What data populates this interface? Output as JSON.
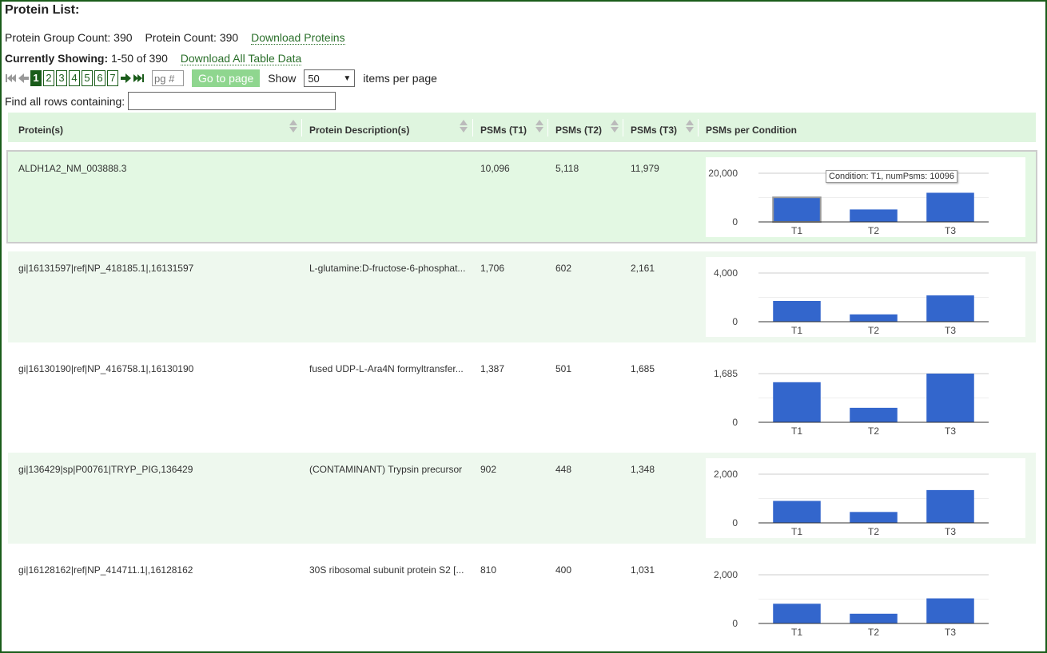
{
  "page": {
    "title": "Protein List:",
    "group_count_text": "Protein Group Count: 390",
    "protein_count_text": "Protein Count: 390",
    "download_proteins": "Download Proteins",
    "showing_label": "Currently Showing:",
    "showing_range": "1-50 of 390",
    "download_all": "Download All Table Data",
    "pages": [
      "1",
      "2",
      "3",
      "4",
      "5",
      "6",
      "7"
    ],
    "current_page": "1",
    "page_input_placeholder": "pg #",
    "go_button": "Go to page",
    "show_label": "Show",
    "per_page_value": "50",
    "items_per_page": "items per page",
    "find_label": "Find all rows containing:"
  },
  "table": {
    "headers": {
      "protein": "Protein(s)",
      "description": "Protein Description(s)",
      "t1": "PSMs (T1)",
      "t2": "PSMs (T2)",
      "t3": "PSMs (T3)",
      "per_condition": "PSMs per Condition"
    },
    "rows": [
      {
        "protein": "ALDH1A2_NM_003888.3",
        "description": "",
        "t1": "10,096",
        "t2": "5,118",
        "t3": "11,979"
      },
      {
        "protein": "gi|16131597|ref|NP_418185.1|,16131597",
        "description": "L-glutamine:D-fructose-6-phosphat...",
        "t1": "1,706",
        "t2": "602",
        "t3": "2,161"
      },
      {
        "protein": "gi|16130190|ref|NP_416758.1|,16130190",
        "description": "fused UDP-L-Ara4N formyltransfer...",
        "t1": "1,387",
        "t2": "501",
        "t3": "1,685"
      },
      {
        "protein": "gi|136429|sp|P00761|TRYP_PIG,136429",
        "description": "(CONTAMINANT) Trypsin precursor",
        "t1": "902",
        "t2": "448",
        "t3": "1,348"
      },
      {
        "protein": "gi|16128162|ref|NP_414711.1|,16128162",
        "description": "30S ribosomal subunit protein S2 [...",
        "t1": "810",
        "t2": "400",
        "t3": "1,031"
      }
    ]
  },
  "chart_data": [
    {
      "type": "bar",
      "categories": [
        "T1",
        "T2",
        "T3"
      ],
      "values": [
        10096,
        5118,
        11979
      ],
      "ylim": [
        0,
        20000
      ],
      "yticks": [
        "20,000",
        "0"
      ],
      "color": "#3366cc",
      "tooltip": "Condition: T1, numPsms: 10096"
    },
    {
      "type": "bar",
      "categories": [
        "T1",
        "T2",
        "T3"
      ],
      "values": [
        1706,
        602,
        2161
      ],
      "ylim": [
        0,
        4000
      ],
      "yticks": [
        "4,000",
        "0"
      ],
      "color": "#3366cc"
    },
    {
      "type": "bar",
      "categories": [
        "T1",
        "T2",
        "T3"
      ],
      "values": [
        1387,
        501,
        1685
      ],
      "ylim": [
        0,
        1685
      ],
      "yticks": [
        "1,685",
        "0"
      ],
      "color": "#3366cc"
    },
    {
      "type": "bar",
      "categories": [
        "T1",
        "T2",
        "T3"
      ],
      "values": [
        902,
        448,
        1348
      ],
      "ylim": [
        0,
        2000
      ],
      "yticks": [
        "2,000",
        "0"
      ],
      "color": "#3366cc"
    },
    {
      "type": "bar",
      "categories": [
        "T1",
        "T2",
        "T3"
      ],
      "values": [
        810,
        400,
        1031
      ],
      "ylim": [
        0,
        2000
      ],
      "yticks": [
        "2,000",
        "0"
      ],
      "color": "#3366cc"
    }
  ]
}
